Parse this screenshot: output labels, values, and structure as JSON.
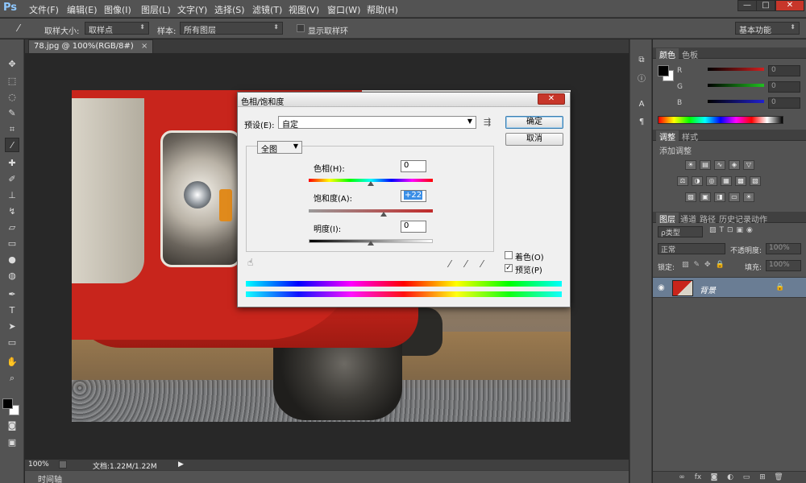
{
  "app": {
    "logo": "Ps"
  },
  "menu": [
    "文件(F)",
    "编辑(E)",
    "图像(I)",
    "图层(L)",
    "文字(Y)",
    "选择(S)",
    "滤镜(T)",
    "视图(V)",
    "窗口(W)",
    "帮助(H)"
  ],
  "window_controls": {
    "minimize": "—",
    "maximize": "□",
    "close": "✕"
  },
  "options": {
    "sample_size_label": "取样大小:",
    "sample_size_value": "取样点",
    "sample_label": "样本:",
    "sample_value": "所有图层",
    "show_ring_label": "显示取样环",
    "workspace": "基本功能"
  },
  "document": {
    "tab_title": "78.jpg @ 100%(RGB/8#)",
    "tab_close": "×",
    "zoom": "100%",
    "doc_info": "文档:1.22M/1.22M",
    "timeline": "时间轴"
  },
  "color_panel": {
    "tabs": [
      "颜色",
      "色板"
    ],
    "channels": [
      {
        "label": "R",
        "value": "0",
        "color": "#d02020"
      },
      {
        "label": "G",
        "value": "0",
        "color": "#20c020"
      },
      {
        "label": "B",
        "value": "0",
        "color": "#2020d0"
      }
    ]
  },
  "adjustments_panel": {
    "tabs": [
      "调整",
      "样式"
    ],
    "heading": "添加调整",
    "row1_icons": [
      "brightness-icon",
      "levels-icon",
      "curves-icon",
      "exposure-icon",
      "vibrance-icon"
    ],
    "row2_icons": [
      "hue-sat-icon",
      "color-balance-icon",
      "bw-icon",
      "photo-filter-icon",
      "channel-mixer-icon",
      "color-lookup-icon"
    ],
    "row3_icons": [
      "invert-icon",
      "posterize-icon",
      "threshold-icon",
      "selective-color-icon",
      "gradient-map-icon"
    ]
  },
  "layers_panel": {
    "tabs": [
      "图层",
      "通道",
      "路径",
      "历史记录",
      "动作"
    ],
    "filter_kind": "ρ类型",
    "blend_mode": "正常",
    "opacity_label": "不透明度:",
    "opacity_value": "100%",
    "lock_label": "锁定:",
    "fill_label": "填充:",
    "fill_value": "100%",
    "layer_name": "背景"
  },
  "dialog": {
    "title": "色相/饱和度",
    "close": "✕",
    "preset_label": "预设(E):",
    "preset_value": "自定",
    "ok": "确定",
    "cancel": "取消",
    "channel": "全图",
    "hue_label": "色相(H):",
    "hue_value": "0",
    "saturation_label": "饱和度(A):",
    "saturation_value": "+22",
    "lightness_label": "明度(I):",
    "lightness_value": "0",
    "colorize_label": "着色(O)",
    "colorize_checked": false,
    "preview_label": "预览(P)",
    "preview_checked": true,
    "check_mark": "✓"
  }
}
